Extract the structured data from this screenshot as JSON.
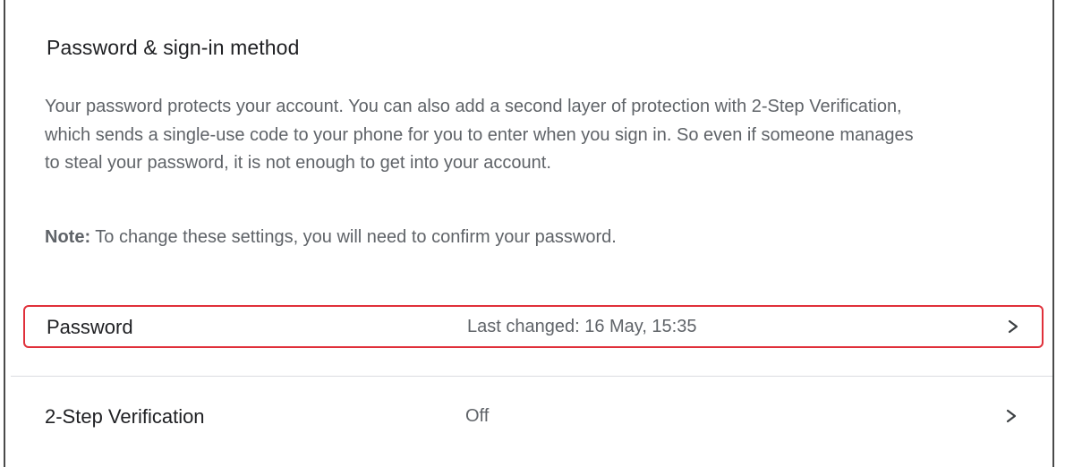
{
  "section": {
    "title": "Password & sign-in method",
    "description": "Your password protects your account. You can also add a second layer of protection with 2-Step Verification, which sends a single-use code to your phone for you to enter when you sign in. So even if someone manages to steal your password, it is not enough to get into your account.",
    "note_label": "Note:",
    "note_text": " To change these settings, you will need to confirm your password."
  },
  "rows": [
    {
      "label": "Password",
      "value": "Last changed: 16 May, 15:35",
      "icon": "chevron-right-icon",
      "highlighted": true
    },
    {
      "label": "2-Step Verification",
      "value": "Off",
      "icon": "chevron-right-icon",
      "highlighted": false
    }
  ],
  "colors": {
    "highlight_border": "#e0303a",
    "text_primary": "#202124",
    "text_secondary": "#5f6368",
    "divider": "#dadce0"
  }
}
